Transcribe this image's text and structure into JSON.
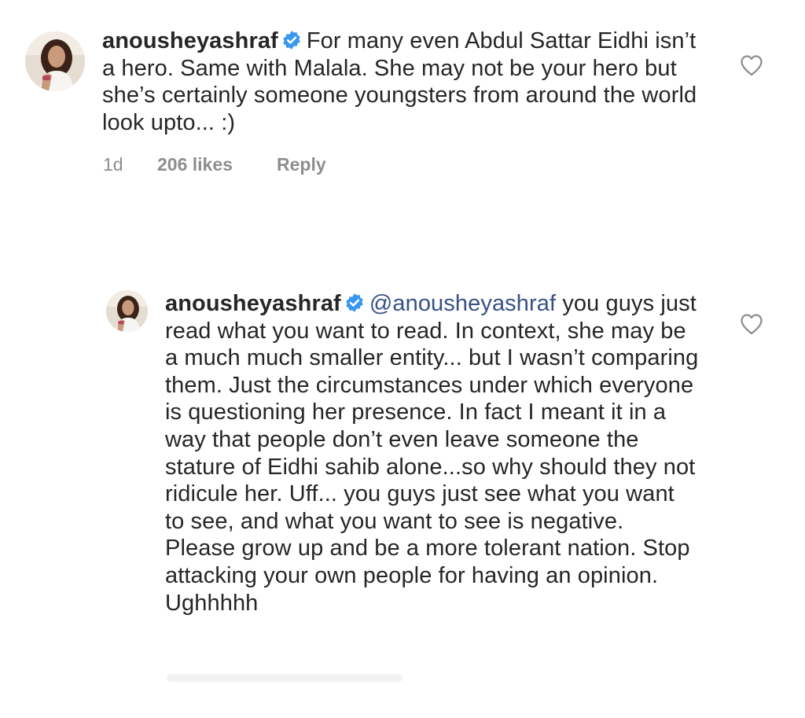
{
  "comments": [
    {
      "username": "anousheyashraf",
      "verified": true,
      "mention": "",
      "text": "For many even Abdul Sattar Eidhi isn’t a hero. Same with Malala. She may not be your hero but she’s certainly someone youngsters from around the world look upto... :)",
      "time": "1d",
      "likes": "206 likes",
      "reply_label": "Reply"
    },
    {
      "username": "anousheyashraf",
      "verified": true,
      "mention": "@anousheyashraf",
      "text": "you guys just read what you want to read. In context, she may be a much much smaller entity... but I wasn’t comparing them. Just the circumstances under which everyone is questioning her presence. In fact I meant it in a way that people don’t even leave someone the stature of Eidhi sahib alone...so why should they not ridicule her. Uff... you guys just see what you want to see, and what you want to see is negative. Please grow up and be a more tolerant nation. Stop attacking your own people for having an opinion. Ughhhhh"
    }
  ],
  "icons": {
    "verified": "verified-badge-icon",
    "like": "heart-outline-icon",
    "avatar": "profile-photo"
  },
  "colors": {
    "text": "#262626",
    "secondary": "#8e8e8e",
    "verified": "#3897f0",
    "mention": "#385185"
  }
}
